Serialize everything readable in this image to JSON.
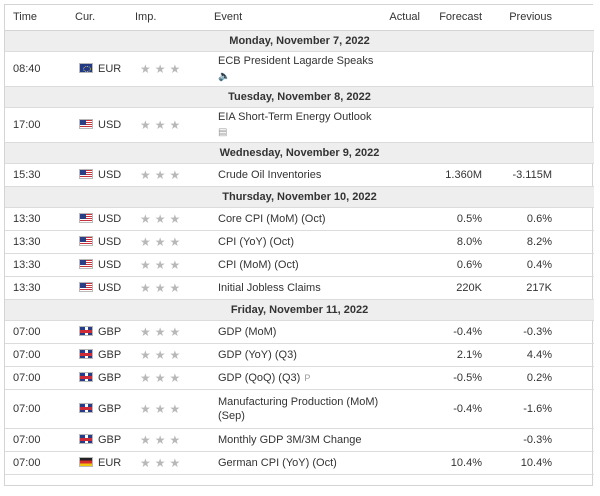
{
  "headers": {
    "time": "Time",
    "currency": "Cur.",
    "importance": "Imp.",
    "event": "Event",
    "actual": "Actual",
    "forecast": "Forecast",
    "previous": "Previous"
  },
  "days": [
    {
      "date": "Monday, November 7, 2022",
      "events": [
        {
          "time": "08:40",
          "currency": "EUR",
          "flag": "eu-flag-icon",
          "event": "ECB President Lagarde Speaks",
          "icon": "speaker-icon",
          "actual": "",
          "forecast": "",
          "previous": ""
        }
      ]
    },
    {
      "date": "Tuesday, November 8, 2022",
      "events": [
        {
          "time": "17:00",
          "currency": "USD",
          "flag": "us-flag-icon",
          "event": "EIA Short-Term Energy Outlook",
          "icon": "document-icon",
          "actual": "",
          "forecast": "",
          "previous": ""
        }
      ]
    },
    {
      "date": "Wednesday, November 9, 2022",
      "events": [
        {
          "time": "15:30",
          "currency": "USD",
          "flag": "us-flag-icon",
          "event": "Crude Oil Inventories",
          "actual": "",
          "forecast": "1.360M",
          "previous": "-3.115M"
        }
      ]
    },
    {
      "date": "Thursday, November 10, 2022",
      "events": [
        {
          "time": "13:30",
          "currency": "USD",
          "flag": "us-flag-icon",
          "event": "Core CPI (MoM) (Oct)",
          "actual": "",
          "forecast": "0.5%",
          "previous": "0.6%"
        },
        {
          "time": "13:30",
          "currency": "USD",
          "flag": "us-flag-icon",
          "event": "CPI (YoY) (Oct)",
          "actual": "",
          "forecast": "8.0%",
          "previous": "8.2%"
        },
        {
          "time": "13:30",
          "currency": "USD",
          "flag": "us-flag-icon",
          "event": "CPI (MoM) (Oct)",
          "actual": "",
          "forecast": "0.6%",
          "previous": "0.4%"
        },
        {
          "time": "13:30",
          "currency": "USD",
          "flag": "us-flag-icon",
          "event": "Initial Jobless Claims",
          "actual": "",
          "forecast": "220K",
          "previous": "217K"
        }
      ]
    },
    {
      "date": "Friday, November 11, 2022",
      "events": [
        {
          "time": "07:00",
          "currency": "GBP",
          "flag": "gb-flag-icon",
          "event": "GDP (MoM)",
          "actual": "",
          "forecast": "-0.4%",
          "previous": "-0.3%"
        },
        {
          "time": "07:00",
          "currency": "GBP",
          "flag": "gb-flag-icon",
          "event": "GDP (YoY) (Q3)",
          "actual": "",
          "forecast": "2.1%",
          "previous": "4.4%"
        },
        {
          "time": "07:00",
          "currency": "GBP",
          "flag": "gb-flag-icon",
          "event": "GDP (QoQ) (Q3)",
          "icon": "preliminary-icon",
          "icon_text": "P",
          "actual": "",
          "forecast": "-0.5%",
          "previous": "0.2%"
        },
        {
          "time": "07:00",
          "currency": "GBP",
          "flag": "gb-flag-icon",
          "event": "Manufacturing Production (MoM) (Sep)",
          "actual": "",
          "forecast": "-0.4%",
          "previous": "-1.6%"
        },
        {
          "time": "07:00",
          "currency": "GBP",
          "flag": "gb-flag-icon",
          "event": "Monthly GDP 3M/3M Change",
          "actual": "",
          "forecast": "",
          "previous": "-0.3%"
        },
        {
          "time": "07:00",
          "currency": "EUR",
          "flag": "de-flag-icon",
          "event": "German CPI (YoY) (Oct)",
          "actual": "",
          "forecast": "10.4%",
          "previous": "10.4%"
        }
      ]
    }
  ],
  "importance_stars": 3,
  "colors": {
    "star": "#b8b8b8",
    "day_row_bg": "#eeeeee",
    "border": "#dcdcdc"
  }
}
